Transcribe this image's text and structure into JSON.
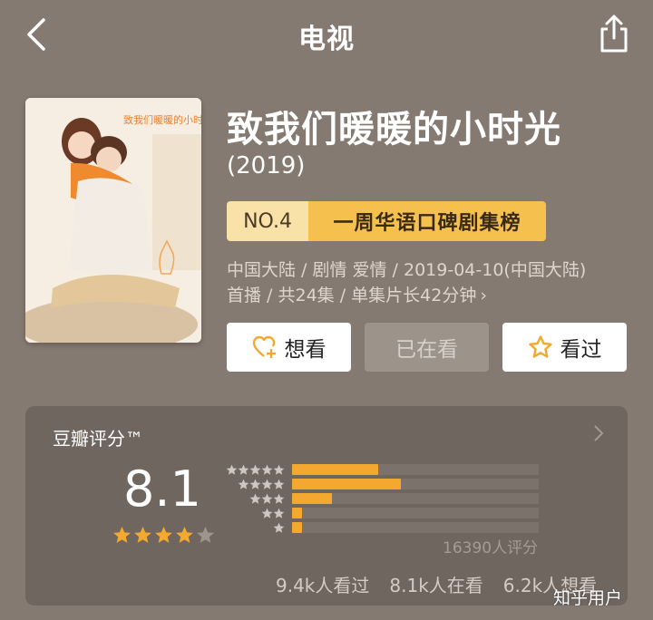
{
  "header": {
    "title": "电视",
    "back_icon": "back-chevron-icon",
    "share_icon": "share-icon"
  },
  "show": {
    "title": "致我们暖暖的小时光",
    "year": "(2019)",
    "poster_title": "致我们暖暖的小时光",
    "rank": {
      "no": "NO.4",
      "list": "一周华语口碑剧集榜"
    },
    "meta_line1": "中国大陆 / 剧情 爱情 / 2019-04-10(中国大陆)",
    "meta_line2": "首播 / 共24集 / 单集片长42分钟"
  },
  "actions": {
    "want": "想看",
    "watching": "已在看",
    "watched": "看过"
  },
  "rating": {
    "title": "豆瓣评分™",
    "score": "8.1",
    "stars": 4,
    "distribution": [
      {
        "stars": 5,
        "fraction": 0.35
      },
      {
        "stars": 4,
        "fraction": 0.44
      },
      {
        "stars": 3,
        "fraction": 0.16
      },
      {
        "stars": 2,
        "fraction": 0.04
      },
      {
        "stars": 1,
        "fraction": 0.04
      }
    ],
    "count": "16390人评分",
    "stats": [
      "9.4k人看过",
      "8.1k人在看",
      "6.2k人想看"
    ]
  },
  "watermark": "知乎用户",
  "colors": {
    "background": "#857a71",
    "accent": "#f3a82e",
    "badge": "#f6c04e"
  }
}
